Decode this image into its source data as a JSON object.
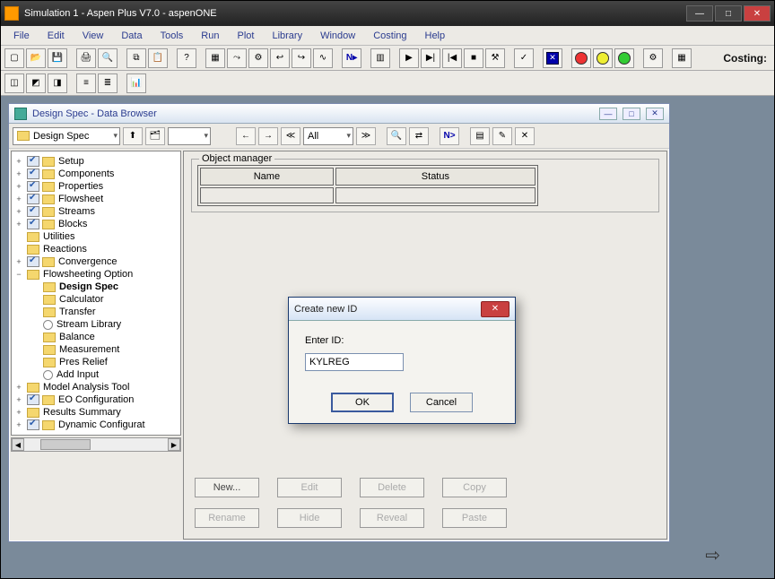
{
  "window": {
    "title": "Simulation 1 - Aspen Plus V7.0 - aspenONE"
  },
  "menu": {
    "items": [
      "File",
      "Edit",
      "View",
      "Data",
      "Tools",
      "Run",
      "Plot",
      "Library",
      "Window",
      "Costing",
      "Help"
    ]
  },
  "toolbar_right_label": "Costing:",
  "child": {
    "title": "Design Spec - Data Browser",
    "combo_objects": "Design Spec",
    "combo_filter": "All",
    "next_label": "N>"
  },
  "tree": {
    "items": [
      {
        "exp": "+",
        "chk": true,
        "fold": true,
        "label": "Setup",
        "indent": 0
      },
      {
        "exp": "+",
        "chk": true,
        "fold": true,
        "label": "Components",
        "indent": 0
      },
      {
        "exp": "+",
        "chk": true,
        "fold": true,
        "label": "Properties",
        "indent": 0
      },
      {
        "exp": "+",
        "chk": true,
        "fold": true,
        "label": "Flowsheet",
        "indent": 0
      },
      {
        "exp": "+",
        "chk": true,
        "fold": true,
        "label": "Streams",
        "indent": 0
      },
      {
        "exp": "+",
        "chk": true,
        "fold": true,
        "label": "Blocks",
        "indent": 0
      },
      {
        "exp": "",
        "chk": false,
        "fold": true,
        "label": "Utilities",
        "indent": 0,
        "nochk": true
      },
      {
        "exp": "",
        "chk": false,
        "fold": true,
        "label": "Reactions",
        "indent": 0,
        "nochk": true
      },
      {
        "exp": "+",
        "chk": true,
        "fold": true,
        "label": "Convergence",
        "indent": 0
      },
      {
        "exp": "−",
        "chk": false,
        "fold": true,
        "label": "Flowsheeting Option",
        "indent": 0,
        "nochk": true
      },
      {
        "exp": "",
        "chk": false,
        "fold": true,
        "label": "Design Spec",
        "indent": 1,
        "bold": true,
        "nochk": true,
        "noexp": true
      },
      {
        "exp": "",
        "chk": false,
        "fold": true,
        "label": "Calculator",
        "indent": 1,
        "nochk": true,
        "noexp": true
      },
      {
        "exp": "",
        "chk": false,
        "fold": true,
        "label": "Transfer",
        "indent": 1,
        "nochk": true,
        "noexp": true
      },
      {
        "exp": "",
        "chk": false,
        "circ": true,
        "label": "Stream Library",
        "indent": 1,
        "nochk": true,
        "noexp": true
      },
      {
        "exp": "",
        "chk": false,
        "fold": true,
        "label": "Balance",
        "indent": 1,
        "nochk": true,
        "noexp": true
      },
      {
        "exp": "",
        "chk": false,
        "fold": true,
        "label": "Measurement",
        "indent": 1,
        "nochk": true,
        "noexp": true
      },
      {
        "exp": "",
        "chk": false,
        "fold": true,
        "label": "Pres Relief",
        "indent": 1,
        "nochk": true,
        "noexp": true
      },
      {
        "exp": "",
        "chk": false,
        "circ": true,
        "label": "Add Input",
        "indent": 1,
        "nochk": true,
        "noexp": true
      },
      {
        "exp": "+",
        "chk": false,
        "fold": true,
        "label": "Model Analysis Tool",
        "indent": 0,
        "nochk": true
      },
      {
        "exp": "+",
        "chk": true,
        "fold": true,
        "label": "EO Configuration",
        "indent": 0
      },
      {
        "exp": "+",
        "chk": false,
        "fold": true,
        "label": "Results Summary",
        "indent": 0,
        "nochk": true
      },
      {
        "exp": "+",
        "chk": true,
        "fold": true,
        "label": "Dynamic Configurat",
        "indent": 0
      }
    ]
  },
  "object_manager": {
    "legend": "Object manager",
    "columns": [
      "Name",
      "Status"
    ]
  },
  "buttons": {
    "row1": [
      "New...",
      "Edit",
      "Delete",
      "Copy"
    ],
    "row2": [
      "Rename",
      "Hide",
      "Reveal",
      "Paste"
    ]
  },
  "dialog": {
    "title": "Create new ID",
    "label": "Enter ID:",
    "value": "KYLREG",
    "ok": "OK",
    "cancel": "Cancel"
  }
}
